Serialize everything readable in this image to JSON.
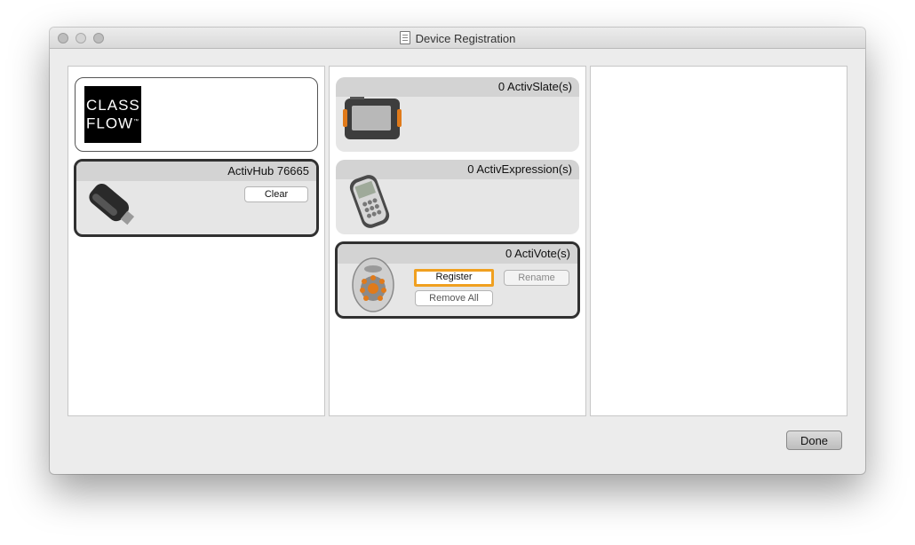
{
  "window": {
    "title": "Device Registration"
  },
  "classflow": {
    "logo_line1": "CLASS",
    "logo_line2": "FLOW",
    "logo_tm": "™"
  },
  "hub": {
    "label": "ActivHub 76665",
    "clear_label": "Clear"
  },
  "slate": {
    "label": "0 ActivSlate(s)"
  },
  "expression": {
    "label": "0 ActivExpression(s)"
  },
  "vote": {
    "label": "0 ActiVote(s)",
    "register_label": "Register",
    "rename_label": "Rename",
    "remove_all_label": "Remove All"
  },
  "footer": {
    "done_label": "Done"
  },
  "colors": {
    "accent_focus": "#f0a020",
    "selected_border": "#303030",
    "device_orange": "#e07a1a"
  }
}
